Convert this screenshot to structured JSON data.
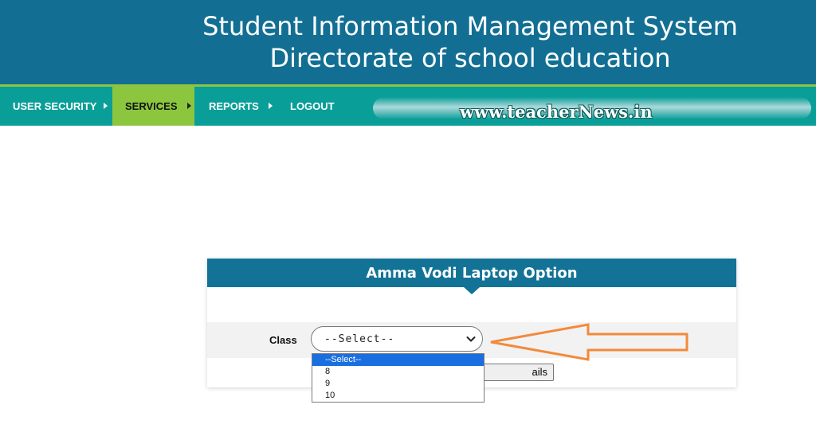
{
  "header": {
    "title_line1": "Student Information Management System",
    "title_line2": "Directorate of school education"
  },
  "nav": {
    "items": [
      {
        "label": "USER SECURITY"
      },
      {
        "label": "SERVICES",
        "active": true
      },
      {
        "label": "REPORTS"
      },
      {
        "label": "LOGOUT"
      }
    ]
  },
  "watermark": "www.teacherNews.in",
  "panel": {
    "title": "Amma Vodi Laptop Option",
    "class_label": "Class",
    "select_value": "--Select--",
    "button_label": "ails"
  },
  "dropdown": {
    "options": [
      "--Select--",
      "8",
      "9",
      "10"
    ],
    "selected_index": 0
  },
  "colors": {
    "header_bg": "#126f93",
    "nav_bg": "#0a9e99",
    "nav_active": "#8cc63f",
    "panel_header": "#137397",
    "annotation_arrow": "#f28a3c",
    "dropdown_highlight": "#1a6fe0"
  }
}
